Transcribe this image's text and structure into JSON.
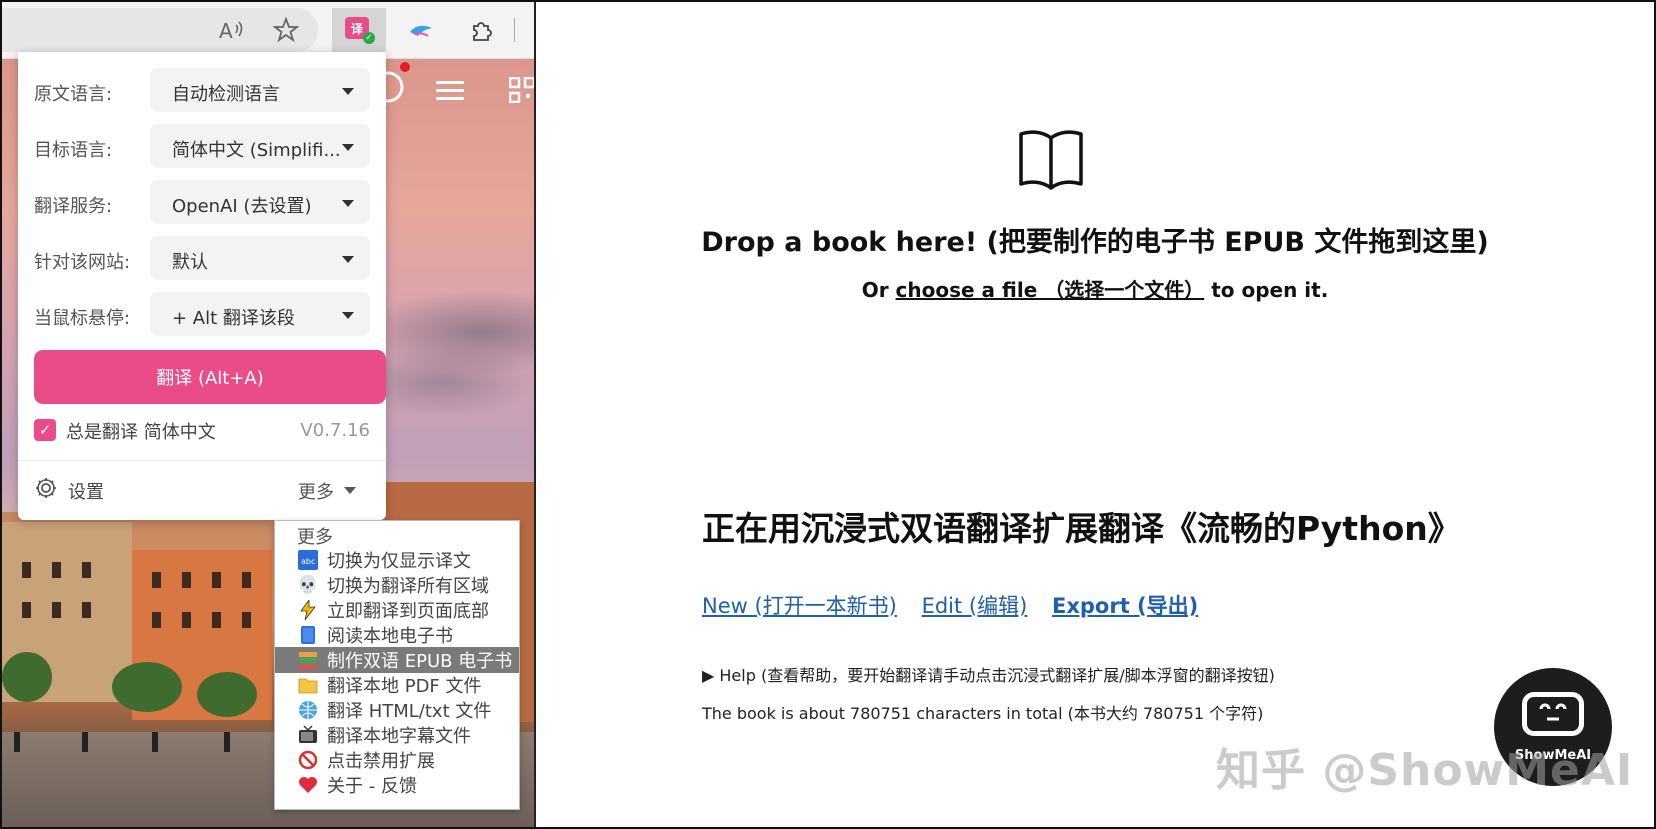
{
  "browser_toolbar": {
    "read_aloud_icon": "À’",
    "favorite_icon": "☆",
    "extensions_icon": "⚙"
  },
  "popup": {
    "rows": [
      {
        "label": "原文语言:",
        "value": "自动检测语言"
      },
      {
        "label": "目标语言:",
        "value": "简体中文 (Simplifi..."
      },
      {
        "label": "翻译服务:",
        "value": "OpenAI (去设置)"
      },
      {
        "label": "针对该网站:",
        "value": "默认"
      },
      {
        "label": "当鼠标悬停:",
        "value": "+ Alt 翻译该段"
      }
    ],
    "translate_button": "翻译 (Alt+A)",
    "always_translate_label": "总是翻译 简体中文",
    "always_translate_checked": true,
    "version": "V0.7.16",
    "settings_label": "设置",
    "more_label": "更多"
  },
  "more_menu": {
    "header": "更多",
    "items": [
      {
        "label": "切换为仅显示译文",
        "icon": "abc-icon"
      },
      {
        "label": "切换为翻译所有区域",
        "icon": "skull-icon"
      },
      {
        "label": "立即翻译到页面底部",
        "icon": "lightning-icon"
      },
      {
        "label": "阅读本地电子书",
        "icon": "blue-book-icon"
      },
      {
        "label": "制作双语 EPUB 电子书",
        "icon": "books-icon",
        "selected": true
      },
      {
        "label": "翻译本地 PDF 文件",
        "icon": "folder-icon"
      },
      {
        "label": "翻译 HTML/txt 文件",
        "icon": "globe-icon"
      },
      {
        "label": "翻译本地字幕文件",
        "icon": "tv-icon"
      },
      {
        "label": "点击禁用扩展",
        "icon": "prohibited-icon"
      },
      {
        "label": "关于 - 反馈",
        "icon": "heart-icon"
      }
    ]
  },
  "epub_page": {
    "drop_title": "Drop a book here! (把要制作的电子书 EPUB 文件拖到这里)",
    "or_prefix": "Or",
    "choose_link": "choose a file （选择一个文件）",
    "or_suffix": "to open it.",
    "heading": "正在用沉浸式双语翻译扩展翻译《流畅的Python》",
    "link_new": "New (打开一本新书)",
    "link_edit": "Edit (编辑)",
    "link_export": "Export (导出)",
    "help": "▶ Help (查看帮助，要开始翻译请手动点击沉浸式翻译扩展/脚本浮窗的翻译按钮)",
    "total": "The book is about 780751 characters in total (本书大约 780751 个字符)"
  },
  "watermark": "知乎 @ShowMeAI",
  "bot_label": "ShowMeAI",
  "colors": {
    "accent_pink": "#ea4c89",
    "link_blue": "#1f5fae"
  }
}
